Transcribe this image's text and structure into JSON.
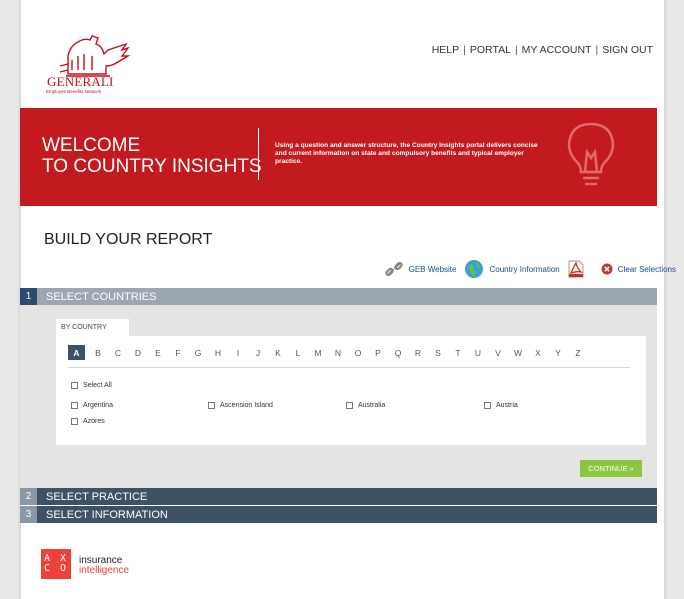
{
  "header": {
    "logo_text": "GENERALI",
    "logo_sub": "Employee Benefits Network",
    "nav": [
      "HELP",
      "PORTAL",
      "MY ACCOUNT",
      "SIGN OUT"
    ]
  },
  "banner": {
    "title_line1": "WELCOME",
    "title_line2": "TO COUNTRY INSIGHTS",
    "description": "Using a question and answer structure, the Country Insights portal delivers concise and current information on state and compulsory benefits and typical employer practice.",
    "color": "#c31a1f"
  },
  "build": {
    "title": "BUILD YOUR REPORT"
  },
  "tools": [
    {
      "label": "GEB Website",
      "icon": "link-icon"
    },
    {
      "label": "Country Information",
      "icon": "globe-icon"
    },
    {
      "label": "",
      "icon": "pdf-icon"
    },
    {
      "label": "Clear Selections",
      "icon": "clear-icon"
    }
  ],
  "sections": [
    {
      "num": "1",
      "label": "SELECT COUNTRIES"
    },
    {
      "num": "2",
      "label": "SELECT PRACTICE"
    },
    {
      "num": "3",
      "label": "SELECT INFORMATION"
    }
  ],
  "countries": {
    "tab_label": "BY COUNTRY",
    "letters": [
      "A",
      "B",
      "C",
      "D",
      "E",
      "F",
      "G",
      "H",
      "I",
      "J",
      "K",
      "L",
      "M",
      "N",
      "O",
      "P",
      "Q",
      "R",
      "S",
      "T",
      "U",
      "V",
      "W",
      "X",
      "Y",
      "Z"
    ],
    "active_letter": "A",
    "select_all": "Select All",
    "items": [
      "Argentina",
      "Ascension Island",
      "Australia",
      "Austria",
      "Azores"
    ]
  },
  "continue_label": "CONTINUE »",
  "footer": {
    "axco_line1": "A X",
    "axco_line2": "C O",
    "brand_line1": "insurance",
    "brand_line2": "intelligence"
  }
}
